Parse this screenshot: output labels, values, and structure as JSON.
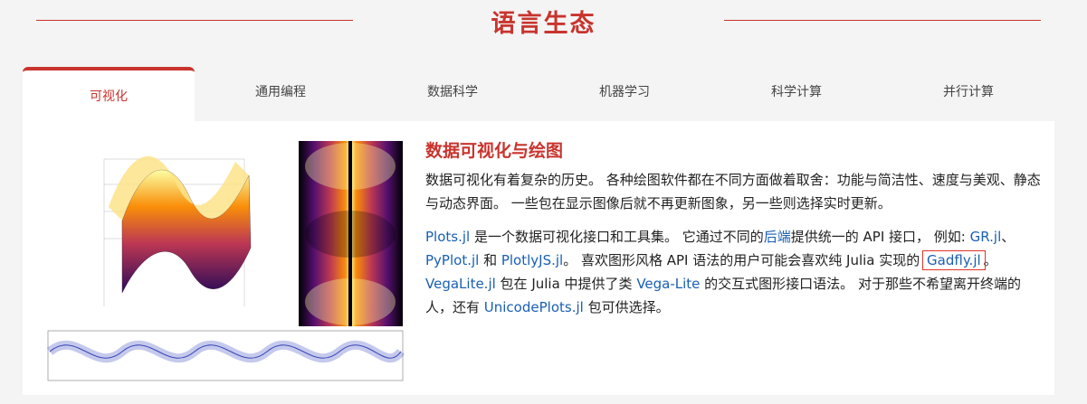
{
  "section": {
    "title": "语言生态"
  },
  "tabs": [
    {
      "label": "可视化",
      "active": true
    },
    {
      "label": "通用编程",
      "active": false
    },
    {
      "label": "数据科学",
      "active": false
    },
    {
      "label": "机器学习",
      "active": false
    },
    {
      "label": "科学计算",
      "active": false
    },
    {
      "label": "并行计算",
      "active": false
    }
  ],
  "content": {
    "heading": "数据可视化与绘图",
    "intro": "数据可视化有着复杂的历史。 各种绘图软件都在不同方面做着取舍：功能与简洁性、速度与美观、静态与动态界面。 一些包在显示图像后就不再更新图象，另一些则选择实时更新。",
    "p2": {
      "plots_link": "Plots.jl",
      "t1": " 是一个数据可视化接口和工具集。 它通过不同的",
      "backends_link": "后端",
      "t2": "提供统一的 API 接口， 例如: ",
      "gr_link": "GR.jl",
      "sep1": "、 ",
      "pyplot_link": "PyPlot.jl",
      "and": " 和 ",
      "plotlyjs_link": "PlotlyJS.jl",
      "t3": "。 喜欢图形风格 API 语法的用户可能会喜欢纯 Julia 实现的 ",
      "gadfly_link": "Gadfly.jl",
      "t4": "。 ",
      "vegalite_link": "VegaLite.jl",
      "t5": " 包在 Julia 中提供了类 ",
      "vegalite2_link": "Vega-Lite",
      "t6": " 的交互式图形接口语法。 对于那些不希望离开终端的人，还有 ",
      "unicodeplots_link": "UnicodePlots.jl",
      "t7": " 包可供选择。"
    }
  },
  "colors": {
    "accent": "#c9342e",
    "link": "#1a5fb4",
    "highlight_box": "#e0342a"
  }
}
